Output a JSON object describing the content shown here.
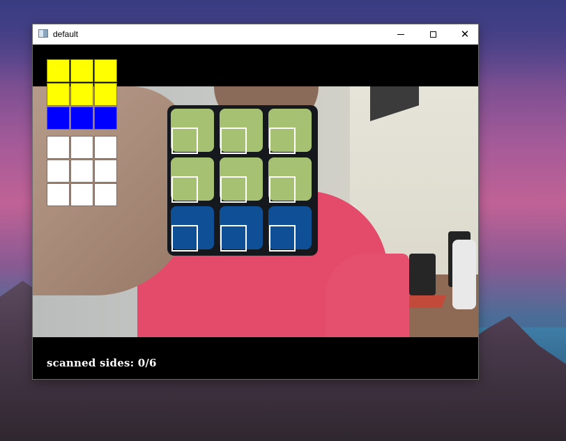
{
  "window": {
    "title": "default",
    "icons": {
      "app": "app-icon",
      "minimize": "minimize-icon",
      "maximize": "maximize-icon",
      "close": "close-icon"
    },
    "close_glyph": "✕"
  },
  "preview": {
    "faces": [
      {
        "colors": [
          "#ffff00",
          "#ffff00",
          "#ffff00",
          "#ffff00",
          "#ffff00",
          "#ffff00",
          "#0000ff",
          "#0000ff",
          "#0000ff"
        ]
      },
      {
        "colors": [
          "#ffffff",
          "#ffffff",
          "#ffffff",
          "#ffffff",
          "#ffffff",
          "#ffffff",
          "#ffffff",
          "#ffffff",
          "#ffffff"
        ]
      }
    ]
  },
  "camera": {
    "cube_face_colors": [
      "#a6c172",
      "#a6c172",
      "#a6c172",
      "#a6c172",
      "#a6c172",
      "#a6c172",
      "#0e4f96",
      "#0e4f96",
      "#0e4f96"
    ]
  },
  "status": {
    "text": "scanned sides: 0/6"
  }
}
